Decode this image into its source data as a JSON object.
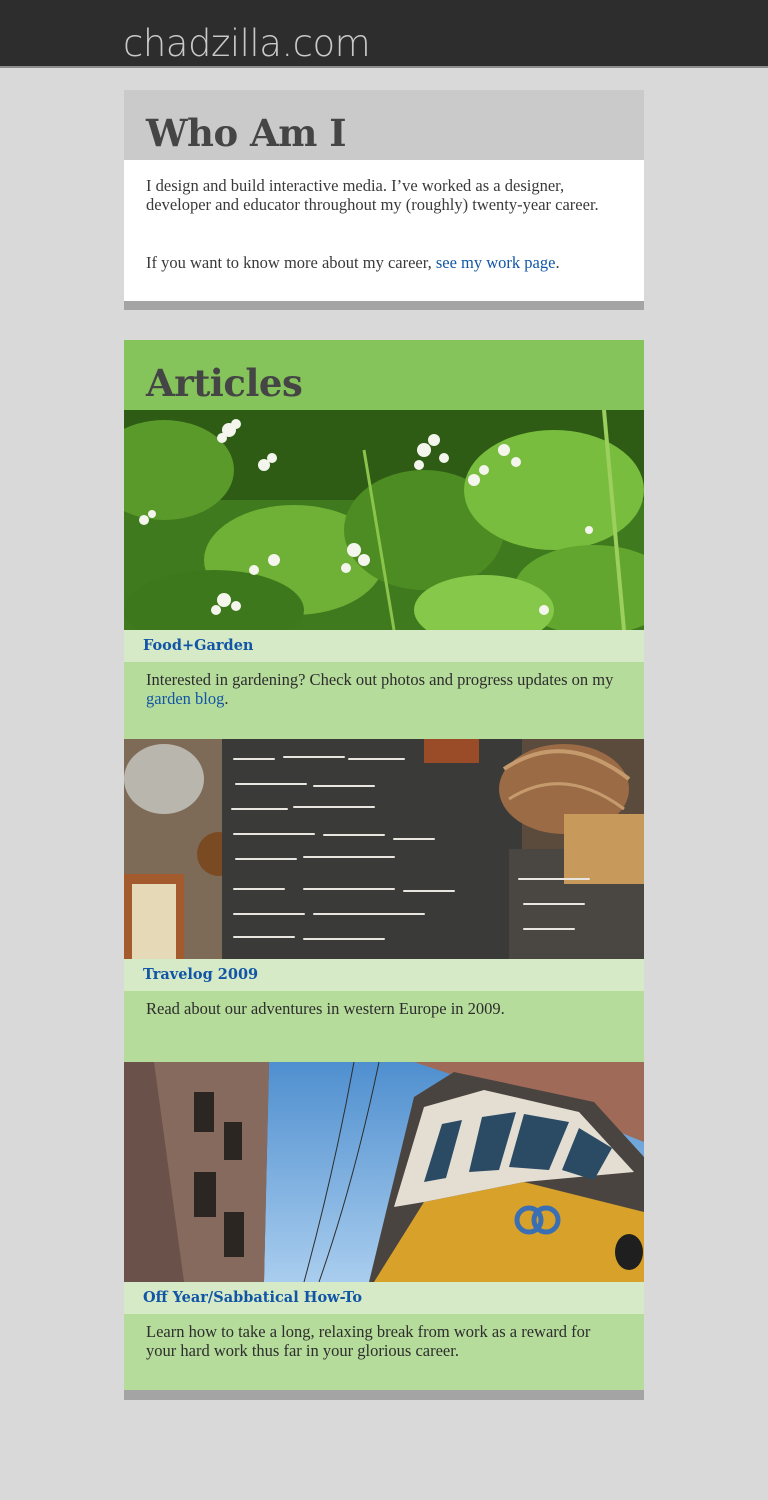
{
  "site": {
    "logo": "chadzilla.com"
  },
  "whoami": {
    "heading": "Who Am I",
    "para1": "I design and build interactive media. I’ve worked as a designer, developer and educator throughout my (roughly) twenty-year career.",
    "para2_prefix": "If you want to know more about my career, ",
    "para2_link": "see my work page",
    "para2_suffix": "."
  },
  "articles": {
    "heading": "Articles",
    "items": [
      {
        "title": "Food+Garden",
        "desc_prefix": "Interested in gardening? Check out photos and progress updates on my ",
        "desc_link": "garden blog",
        "desc_suffix": ".",
        "image": "buckwheat-flowers-photo"
      },
      {
        "title": "Travelog 2009",
        "desc": "Read about our adventures in western Europe in 2009.",
        "image": "italian-chalkboard-menu-photo"
      },
      {
        "title": "Off Year/Sabbatical How-To",
        "desc": "Learn how to take a long, relaxing break from work as a reward for your hard work thus far in your glorious career.",
        "image": "lisbon-tram-photo"
      }
    ]
  },
  "colors": {
    "topbar": "#2d2d2d",
    "whoami_header": "#cacaca",
    "articles_header": "#85c45a",
    "article_title_bg": "#d7eac7",
    "article_desc_bg": "#b6dc9b",
    "link": "#1155a6"
  }
}
